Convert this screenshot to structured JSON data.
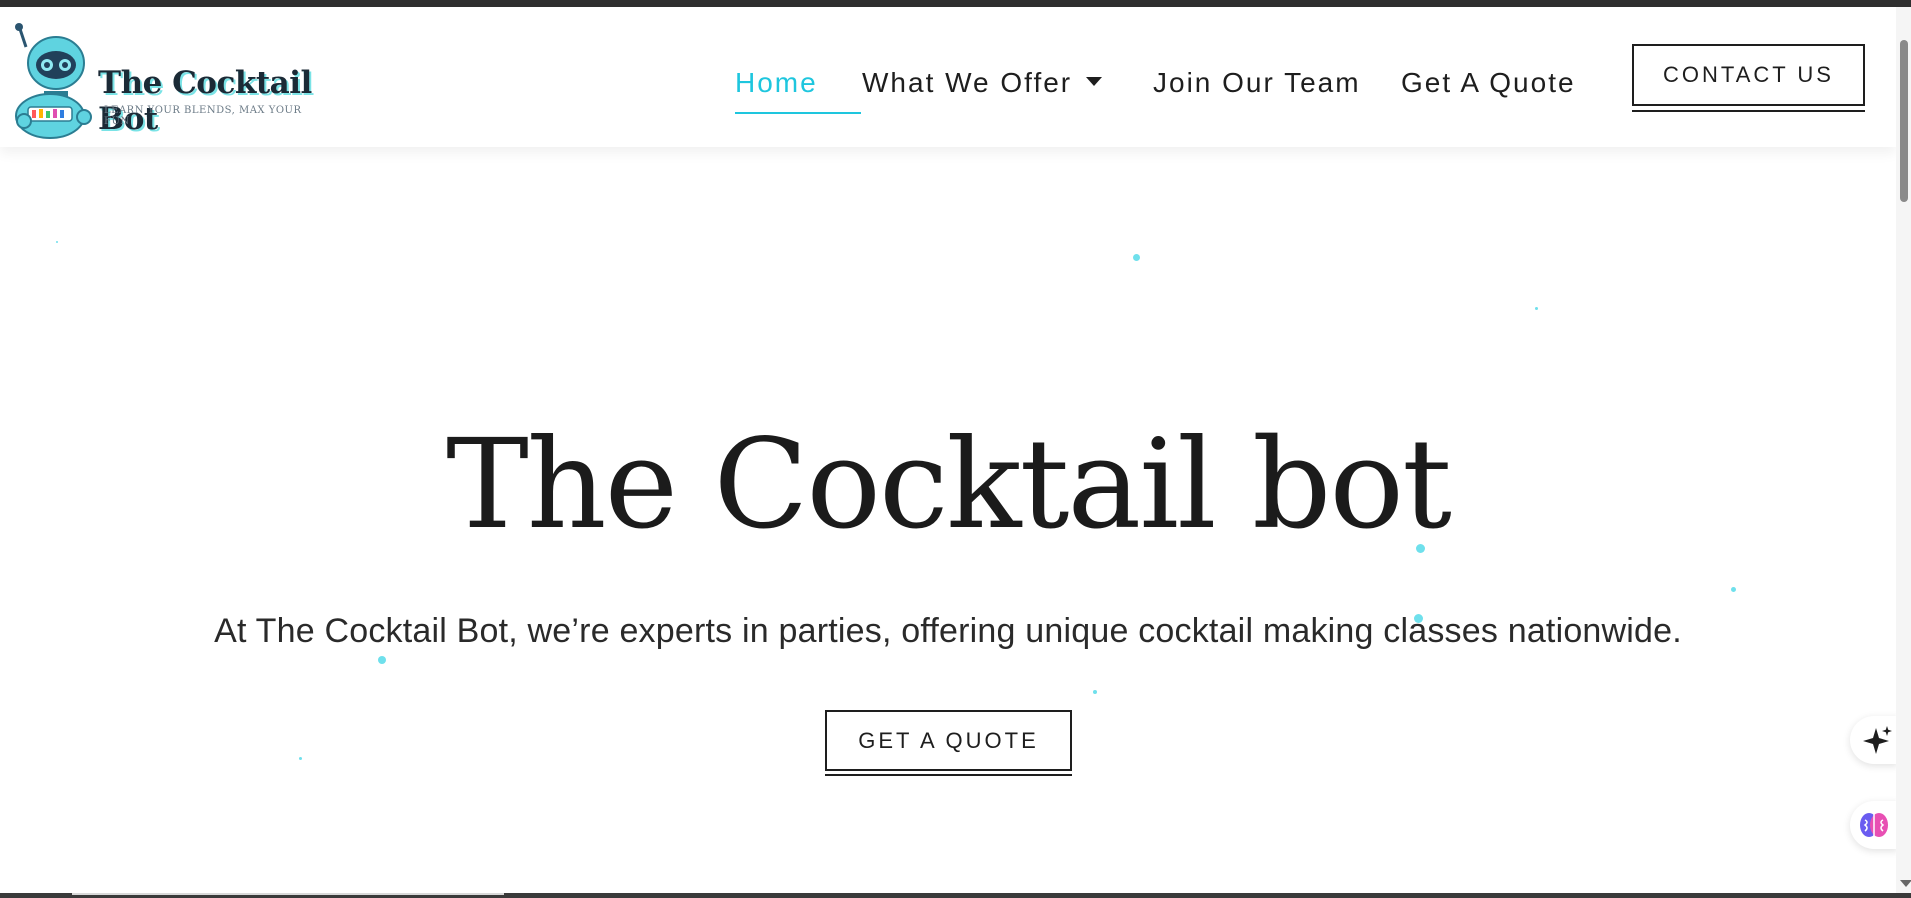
{
  "site": {
    "logo_title": "The Cocktail Bot",
    "logo_tagline": "LEARN YOUR BLENDS, MAX YOUR FUN"
  },
  "nav": {
    "home": "Home",
    "offer": "What We Offer",
    "join": "Join Our Team",
    "quote": "Get A Quote",
    "contact": "CONTACT US"
  },
  "hero": {
    "title": "The Cocktail bot",
    "subtitle": "At The Cocktail Bot, we’re experts in parties, offering unique cocktail making classes nationwide.",
    "cta": "GET A QUOTE"
  },
  "colors": {
    "accent": "#1ec6de",
    "text": "#1e1e1e",
    "dots": "#6fe0ec"
  },
  "icons": [
    "robot-logo-icon",
    "chevron-down-icon",
    "sparkle-icon",
    "brain-icon"
  ]
}
